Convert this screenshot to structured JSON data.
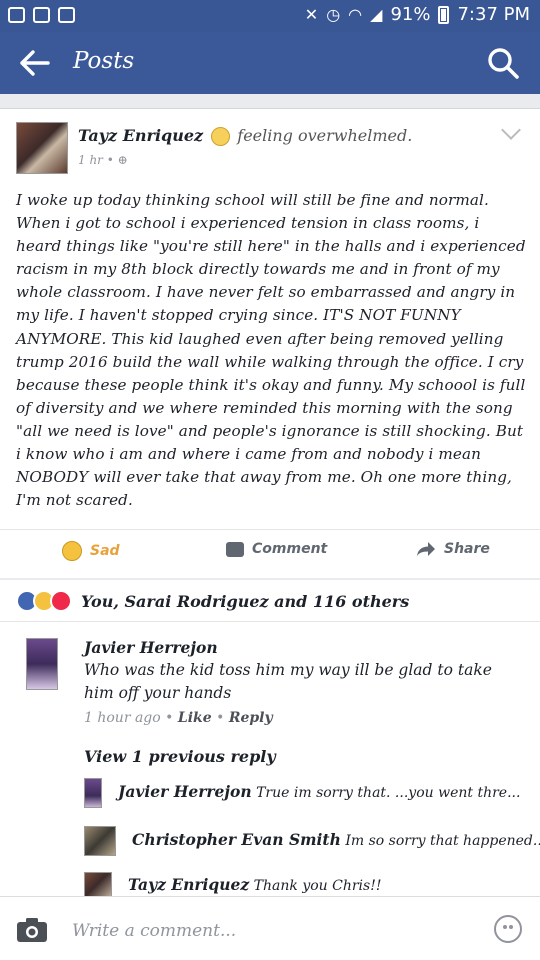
{
  "status_bar": {
    "battery": "91%",
    "time": "7:37 PM",
    "icons": [
      "camera-notif-icon",
      "voicemail-icon",
      "download-icon",
      "mute-icon",
      "alarm-icon",
      "wifi-icon",
      "signal-icon",
      "battery-icon"
    ]
  },
  "header": {
    "title": "Posts"
  },
  "post": {
    "author": "Tayz Enriquez",
    "feeling": "feeling overwhelmed.",
    "time": "1 hr",
    "body": "I woke up today thinking school will still be fine and normal. When i got to school i experienced tension in class rooms, i heard things like \"you're still here\" in the halls and i experienced racism in my 8th block directly towards me and in front of my whole classroom. I have never felt so embarrassed and angry in my life. I haven't stopped crying since. IT'S NOT FUNNY ANYMORE. This kid laughed even after being removed yelling trump 2016 build the wall while walking through the office. I cry because these people think it's okay and funny. My schoool is full of diversity and we where reminded this morning with the song \"all we need is love\" and people's ignorance is still shocking. But i know who i am and where i came from and nobody i mean NOBODY will ever take that away from me. Oh one more thing, I'm not scared.",
    "actions": {
      "reaction": "Sad",
      "comment": "Comment",
      "share": "Share"
    }
  },
  "reactions": {
    "summary": "You, Sarai Rodriguez and 116 others"
  },
  "comments": [
    {
      "author": "Javier Herrejon",
      "text": "Who was the kid toss him my way ill be glad to take him off your hands",
      "time": "1 hour ago",
      "like": "Like",
      "reply": "Reply"
    }
  ],
  "view_previous": "View 1 previous reply",
  "replies": [
    {
      "author": "Javier Herrejon",
      "text": "True im sorry that. ...you went thre..."
    },
    {
      "author": "Christopher Evan Smith",
      "text": "Im so sorry that happened..."
    },
    {
      "author": "Tayz Enriquez",
      "text": "Thank you Chris!!"
    }
  ],
  "composer": {
    "placeholder": "Write a comment..."
  },
  "colors": {
    "brand": "#3b5998",
    "status_bar": "#3a5795",
    "sad_accent": "#e9a23b",
    "love": "#f0284a",
    "like": "#4267b2"
  }
}
